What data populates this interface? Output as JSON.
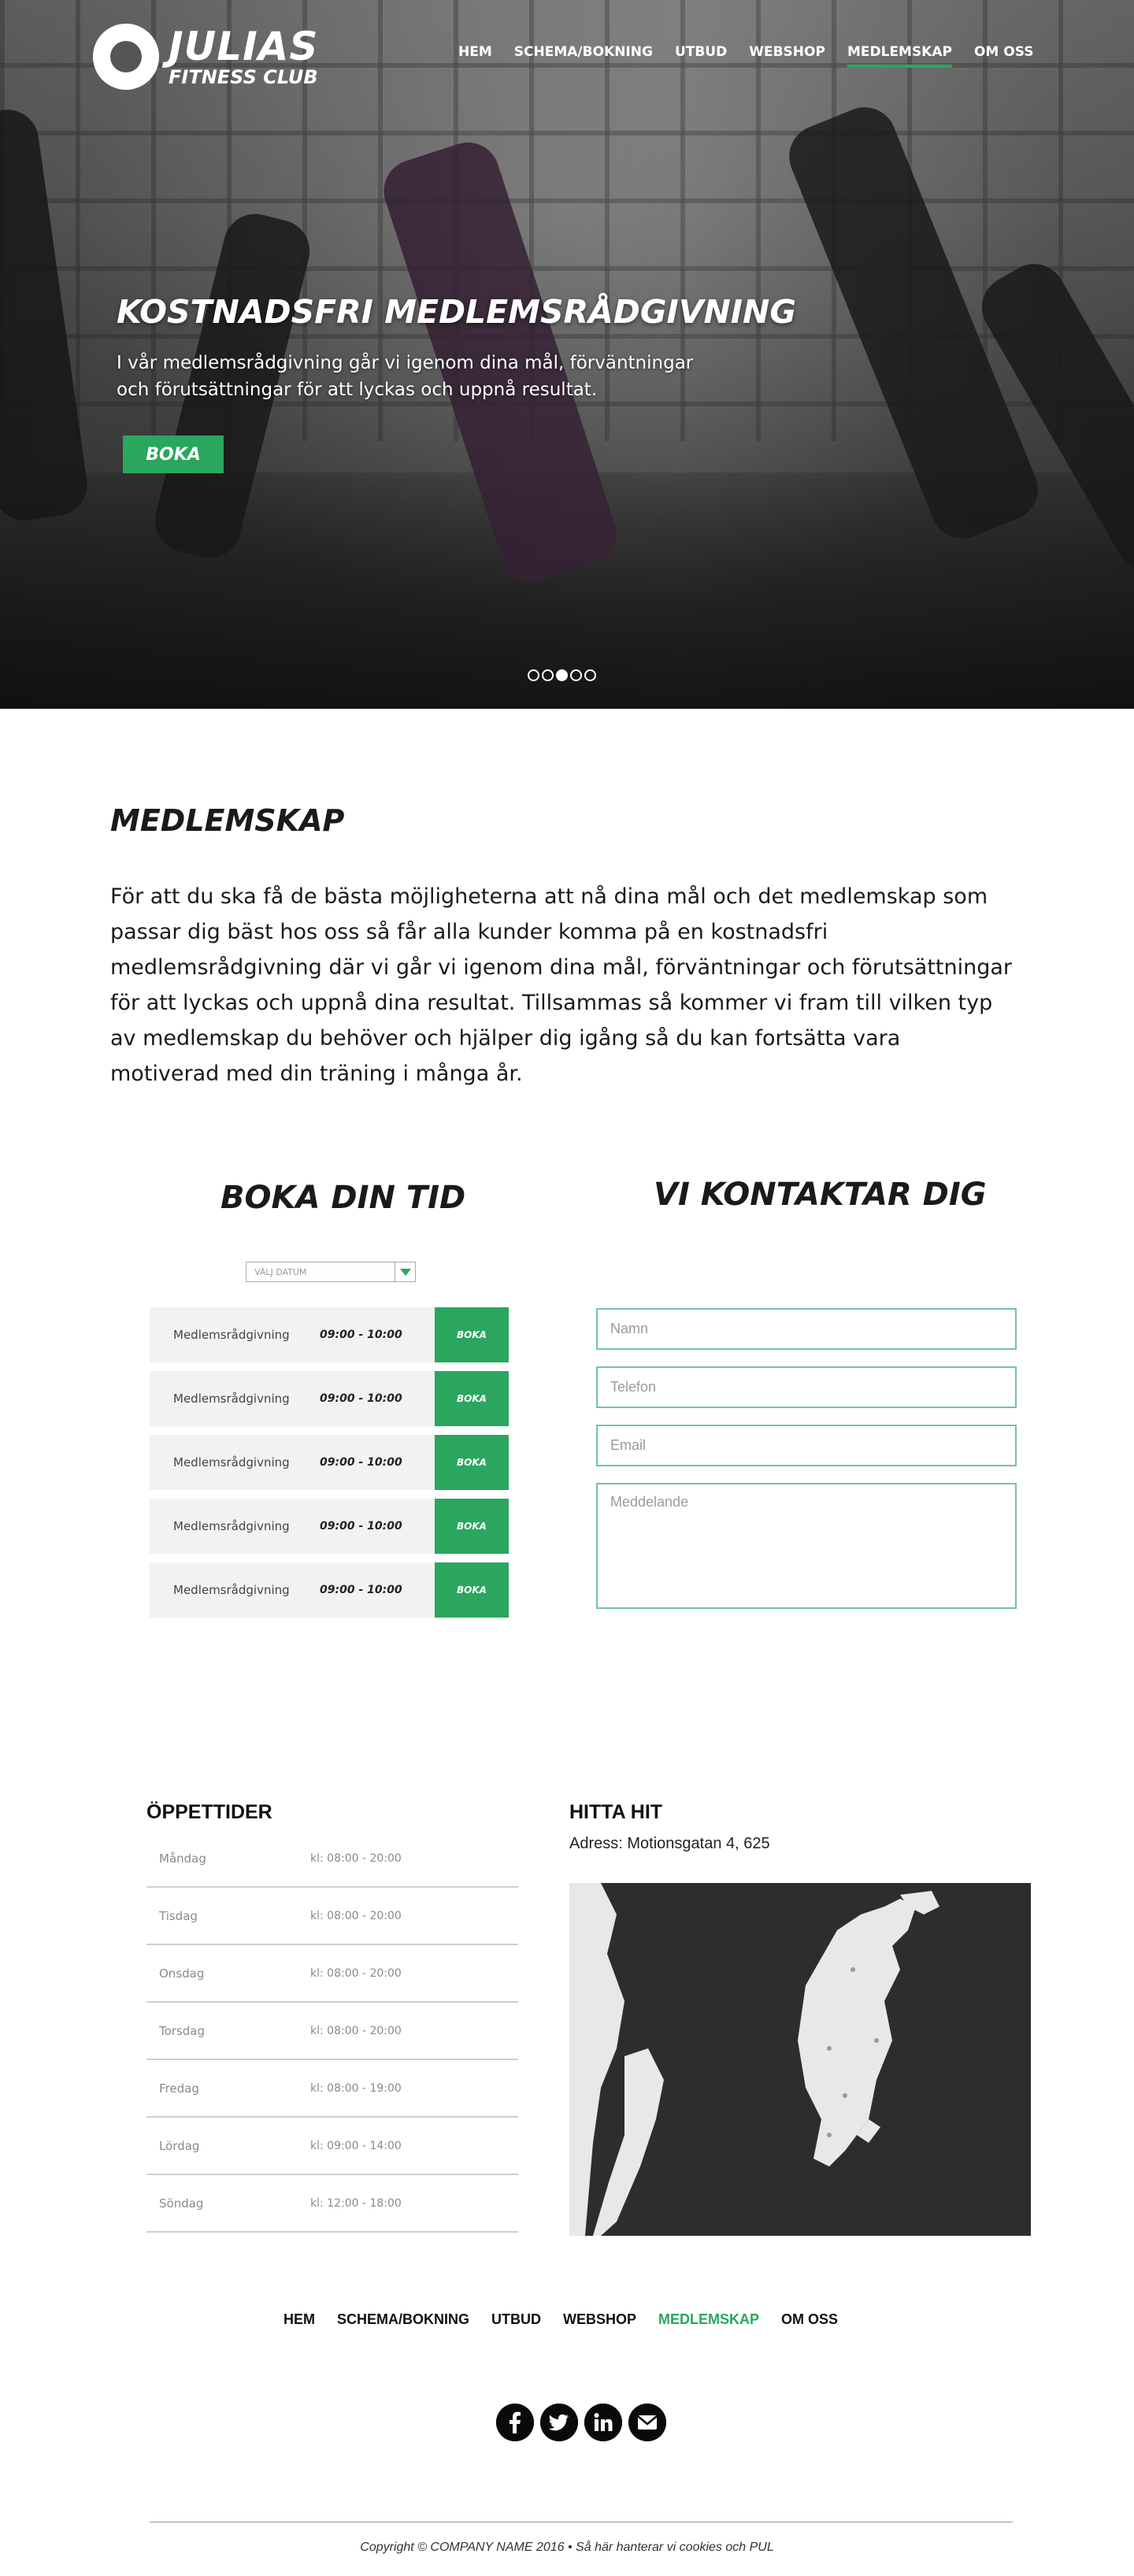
{
  "brand": {
    "name": "JULIAS",
    "tagline": "FITNESS CLUB"
  },
  "nav": [
    "HEM",
    "SCHEMA/BOKNING",
    "UTBUD",
    "WEBSHOP",
    "MEDLEMSKAP",
    "OM OSS"
  ],
  "nav_active": "MEDLEMSKAP",
  "hero": {
    "title": "KOSTNADSFRI MEDLEMSRÅDGIVNING",
    "text": " I vår medlemsrådgivning går vi igenom dina mål, förväntningar och förutsättningar för att lyckas och uppnå resultat.",
    "button": "BOKA",
    "slides_total": 5,
    "slide_active": 3
  },
  "membership": {
    "title": "MEDLEMSKAP",
    "text": "För att du ska få de bästa möjligheterna att nå dina mål och det medlemskap som passar dig bäst hos oss så får alla kunder komma på en kostnadsfri medlemsrådgivning där vi går vi igenom dina mål, förväntningar och förutsättningar för att lyckas och uppnå dina resultat. Tillsammas så kommer vi fram till vilken typ av medlemskap du behöver och hjälper dig igång så du kan fortsätta vara motiverad med din träning i många år."
  },
  "booking": {
    "title": "BOKA DIN TID",
    "date_placeholder": "VÄLJ DATUM",
    "slots": [
      {
        "name": "Medlemsrådgivning",
        "time": "09:00 - 10:00",
        "button": "BOKA"
      },
      {
        "name": "Medlemsrådgivning",
        "time": "09:00 - 10:00",
        "button": "BOKA"
      },
      {
        "name": "Medlemsrådgivning",
        "time": "09:00 - 10:00",
        "button": "BOKA"
      },
      {
        "name": "Medlemsrådgivning",
        "time": "09:00 - 10:00",
        "button": "BOKA"
      },
      {
        "name": "Medlemsrådgivning",
        "time": "09:00 - 10:00",
        "button": "BOKA"
      }
    ]
  },
  "contact": {
    "title": "VI KONTAKTAR DIG",
    "name_placeholder": "Namn",
    "phone_placeholder": "Telefon",
    "email_placeholder": "Email",
    "message_placeholder": "Meddelande"
  },
  "hours": {
    "title": "ÖPPETTIDER",
    "rows": [
      {
        "day": "Måndag",
        "time": "kl: 08:00 - 20:00"
      },
      {
        "day": "Tisdag",
        "time": "kl: 08:00 - 20:00"
      },
      {
        "day": "Onsdag",
        "time": "kl: 08:00 - 20:00"
      },
      {
        "day": "Torsdag",
        "time": "kl: 08:00 - 20:00"
      },
      {
        "day": "Fredag",
        "time": "kl: 08:00 - 19:00"
      },
      {
        "day": "Lördag",
        "time": "kl: 09:00 - 14:00"
      },
      {
        "day": "Söndag",
        "time": "kl: 12:00 - 18:00"
      }
    ]
  },
  "find": {
    "title": "HITTA HIT",
    "address": "Adress: Motionsgatan 4, 625"
  },
  "footer": {
    "nav": [
      "HEM",
      "SCHEMA/BOKNING",
      "UTBUD",
      "WEBSHOP",
      "MEDLEMSKAP",
      "OM OSS"
    ],
    "social": [
      "facebook-icon",
      "twitter-icon",
      "linkedin-icon",
      "email-icon"
    ],
    "copyright": "Copyright © COMPANY NAME 2016 • Så här hanterar vi cookies och PUL"
  },
  "colors": {
    "accent": "#2aa65f",
    "field_border": "#6fc699",
    "map_bg": "#2d2d2d"
  }
}
